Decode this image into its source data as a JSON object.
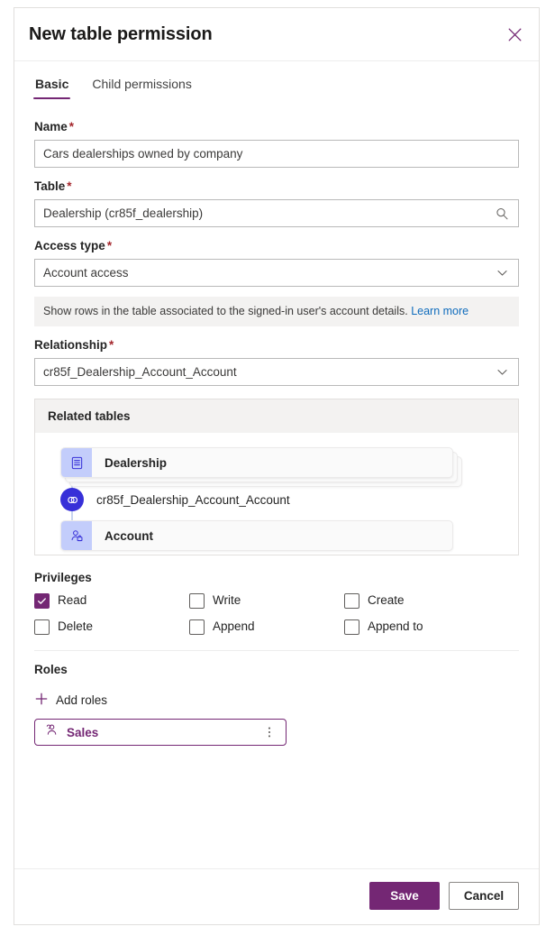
{
  "panel": {
    "title": "New table permission",
    "close_icon": "close-icon"
  },
  "tabs": [
    {
      "label": "Basic",
      "active": true
    },
    {
      "label": "Child permissions",
      "active": false
    }
  ],
  "form": {
    "name": {
      "label": "Name",
      "required": "*",
      "value": "Cars dealerships owned by company"
    },
    "table": {
      "label": "Table",
      "required": "*",
      "value": "Dealership (cr85f_dealership)",
      "icon": "search-icon"
    },
    "access_type": {
      "label": "Access type",
      "required": "*",
      "value": "Account access",
      "icon": "chevron-down-icon",
      "help_text": "Show rows in the table associated to the signed-in user's account details.",
      "help_link": "Learn more"
    },
    "relationship": {
      "label": "Relationship",
      "required": "*",
      "value": "cr85f_Dealership_Account_Account",
      "icon": "chevron-down-icon"
    }
  },
  "related_tables": {
    "heading": "Related tables",
    "source_table": "Dealership",
    "source_icon": "table-icon",
    "relationship_name": "cr85f_Dealership_Account_Account",
    "relationship_icon": "link-icon",
    "target_table": "Account",
    "target_icon": "account-user-icon"
  },
  "privileges": {
    "heading": "Privileges",
    "items": [
      {
        "label": "Read",
        "checked": true
      },
      {
        "label": "Write",
        "checked": false
      },
      {
        "label": "Create",
        "checked": false
      },
      {
        "label": "Delete",
        "checked": false
      },
      {
        "label": "Append",
        "checked": false
      },
      {
        "label": "Append to",
        "checked": false
      }
    ]
  },
  "roles": {
    "heading": "Roles",
    "add_label": "Add roles",
    "add_icon": "plus-icon",
    "chips": [
      {
        "name": "Sales",
        "icon": "role-person-icon",
        "menu_icon": "more-vertical-icon"
      }
    ]
  },
  "footer": {
    "save_label": "Save",
    "cancel_label": "Cancel"
  },
  "colors": {
    "accent": "#742774",
    "link": "#0f6cbd",
    "required": "#a4262c",
    "node": "#3730d8",
    "card_icon_bg": "#c3cdfb"
  }
}
